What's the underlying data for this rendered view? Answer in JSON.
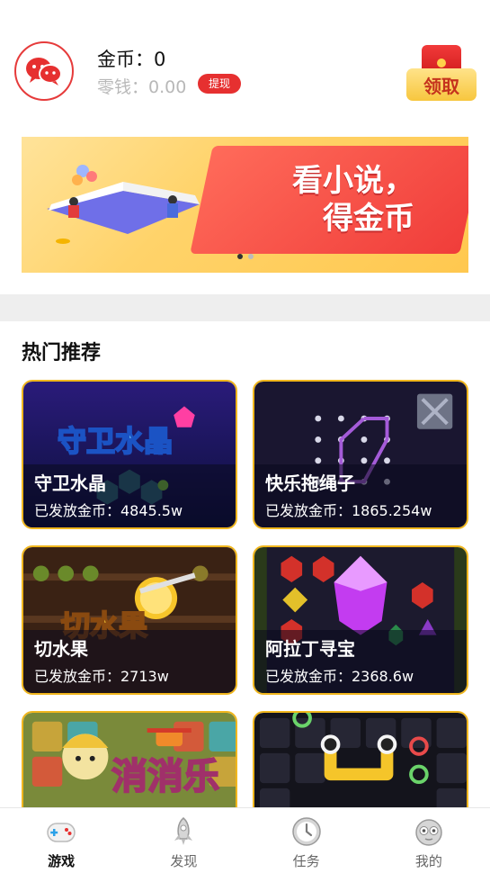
{
  "header": {
    "coins_text": "金币：0",
    "change_text": "零钱：0.00",
    "withdraw_label": "提现",
    "claim_label": "领取"
  },
  "banner": {
    "line1": "看小说，",
    "line2": "得金币"
  },
  "section": {
    "title": "热门推荐"
  },
  "games": [
    {
      "name": "守卫水晶",
      "stat": "已发放金币：4845.5w",
      "logo_text": "守卫水晶"
    },
    {
      "name": "快乐拖绳子",
      "stat": "已发放金币：1865.254w"
    },
    {
      "name": "切水果",
      "stat": "已发放金币：2713w",
      "logo_text": "切水果"
    },
    {
      "name": "阿拉丁寻宝",
      "stat": "已发放金币：2368.6w"
    },
    {
      "name": "",
      "stat": "",
      "logo_text": "消消乐"
    },
    {
      "name": "",
      "stat": ""
    }
  ],
  "nav": [
    {
      "label": "游戏",
      "icon": "gamepad-icon",
      "active": true
    },
    {
      "label": "发现",
      "icon": "rocket-icon",
      "active": false
    },
    {
      "label": "任务",
      "icon": "clock-icon",
      "active": false
    },
    {
      "label": "我的",
      "icon": "robot-face-icon",
      "active": false
    }
  ],
  "colors": {
    "accent": "#e63030",
    "card_border": "#f0b61d",
    "nav_active": "#111111",
    "nav_inactive": "#666666"
  }
}
